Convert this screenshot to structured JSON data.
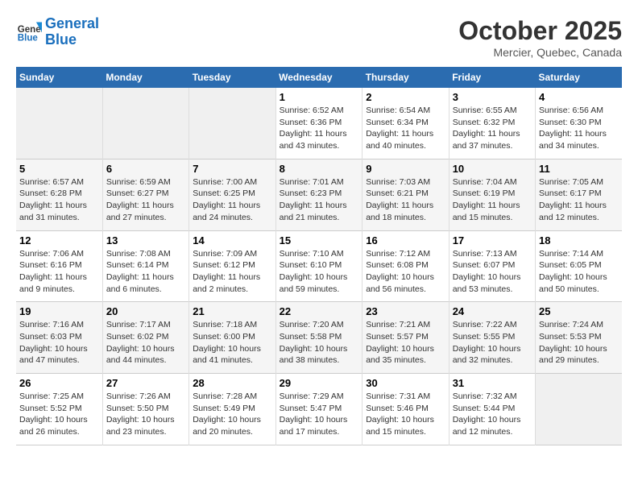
{
  "header": {
    "logo_line1": "General",
    "logo_line2": "Blue",
    "month": "October 2025",
    "location": "Mercier, Quebec, Canada"
  },
  "days_of_week": [
    "Sunday",
    "Monday",
    "Tuesday",
    "Wednesday",
    "Thursday",
    "Friday",
    "Saturday"
  ],
  "weeks": [
    [
      {
        "num": "",
        "info": ""
      },
      {
        "num": "",
        "info": ""
      },
      {
        "num": "",
        "info": ""
      },
      {
        "num": "1",
        "info": "Sunrise: 6:52 AM\nSunset: 6:36 PM\nDaylight: 11 hours and 43 minutes."
      },
      {
        "num": "2",
        "info": "Sunrise: 6:54 AM\nSunset: 6:34 PM\nDaylight: 11 hours and 40 minutes."
      },
      {
        "num": "3",
        "info": "Sunrise: 6:55 AM\nSunset: 6:32 PM\nDaylight: 11 hours and 37 minutes."
      },
      {
        "num": "4",
        "info": "Sunrise: 6:56 AM\nSunset: 6:30 PM\nDaylight: 11 hours and 34 minutes."
      }
    ],
    [
      {
        "num": "5",
        "info": "Sunrise: 6:57 AM\nSunset: 6:28 PM\nDaylight: 11 hours and 31 minutes."
      },
      {
        "num": "6",
        "info": "Sunrise: 6:59 AM\nSunset: 6:27 PM\nDaylight: 11 hours and 27 minutes."
      },
      {
        "num": "7",
        "info": "Sunrise: 7:00 AM\nSunset: 6:25 PM\nDaylight: 11 hours and 24 minutes."
      },
      {
        "num": "8",
        "info": "Sunrise: 7:01 AM\nSunset: 6:23 PM\nDaylight: 11 hours and 21 minutes."
      },
      {
        "num": "9",
        "info": "Sunrise: 7:03 AM\nSunset: 6:21 PM\nDaylight: 11 hours and 18 minutes."
      },
      {
        "num": "10",
        "info": "Sunrise: 7:04 AM\nSunset: 6:19 PM\nDaylight: 11 hours and 15 minutes."
      },
      {
        "num": "11",
        "info": "Sunrise: 7:05 AM\nSunset: 6:17 PM\nDaylight: 11 hours and 12 minutes."
      }
    ],
    [
      {
        "num": "12",
        "info": "Sunrise: 7:06 AM\nSunset: 6:16 PM\nDaylight: 11 hours and 9 minutes."
      },
      {
        "num": "13",
        "info": "Sunrise: 7:08 AM\nSunset: 6:14 PM\nDaylight: 11 hours and 6 minutes."
      },
      {
        "num": "14",
        "info": "Sunrise: 7:09 AM\nSunset: 6:12 PM\nDaylight: 11 hours and 2 minutes."
      },
      {
        "num": "15",
        "info": "Sunrise: 7:10 AM\nSunset: 6:10 PM\nDaylight: 10 hours and 59 minutes."
      },
      {
        "num": "16",
        "info": "Sunrise: 7:12 AM\nSunset: 6:08 PM\nDaylight: 10 hours and 56 minutes."
      },
      {
        "num": "17",
        "info": "Sunrise: 7:13 AM\nSunset: 6:07 PM\nDaylight: 10 hours and 53 minutes."
      },
      {
        "num": "18",
        "info": "Sunrise: 7:14 AM\nSunset: 6:05 PM\nDaylight: 10 hours and 50 minutes."
      }
    ],
    [
      {
        "num": "19",
        "info": "Sunrise: 7:16 AM\nSunset: 6:03 PM\nDaylight: 10 hours and 47 minutes."
      },
      {
        "num": "20",
        "info": "Sunrise: 7:17 AM\nSunset: 6:02 PM\nDaylight: 10 hours and 44 minutes."
      },
      {
        "num": "21",
        "info": "Sunrise: 7:18 AM\nSunset: 6:00 PM\nDaylight: 10 hours and 41 minutes."
      },
      {
        "num": "22",
        "info": "Sunrise: 7:20 AM\nSunset: 5:58 PM\nDaylight: 10 hours and 38 minutes."
      },
      {
        "num": "23",
        "info": "Sunrise: 7:21 AM\nSunset: 5:57 PM\nDaylight: 10 hours and 35 minutes."
      },
      {
        "num": "24",
        "info": "Sunrise: 7:22 AM\nSunset: 5:55 PM\nDaylight: 10 hours and 32 minutes."
      },
      {
        "num": "25",
        "info": "Sunrise: 7:24 AM\nSunset: 5:53 PM\nDaylight: 10 hours and 29 minutes."
      }
    ],
    [
      {
        "num": "26",
        "info": "Sunrise: 7:25 AM\nSunset: 5:52 PM\nDaylight: 10 hours and 26 minutes."
      },
      {
        "num": "27",
        "info": "Sunrise: 7:26 AM\nSunset: 5:50 PM\nDaylight: 10 hours and 23 minutes."
      },
      {
        "num": "28",
        "info": "Sunrise: 7:28 AM\nSunset: 5:49 PM\nDaylight: 10 hours and 20 minutes."
      },
      {
        "num": "29",
        "info": "Sunrise: 7:29 AM\nSunset: 5:47 PM\nDaylight: 10 hours and 17 minutes."
      },
      {
        "num": "30",
        "info": "Sunrise: 7:31 AM\nSunset: 5:46 PM\nDaylight: 10 hours and 15 minutes."
      },
      {
        "num": "31",
        "info": "Sunrise: 7:32 AM\nSunset: 5:44 PM\nDaylight: 10 hours and 12 minutes."
      },
      {
        "num": "",
        "info": ""
      }
    ]
  ]
}
